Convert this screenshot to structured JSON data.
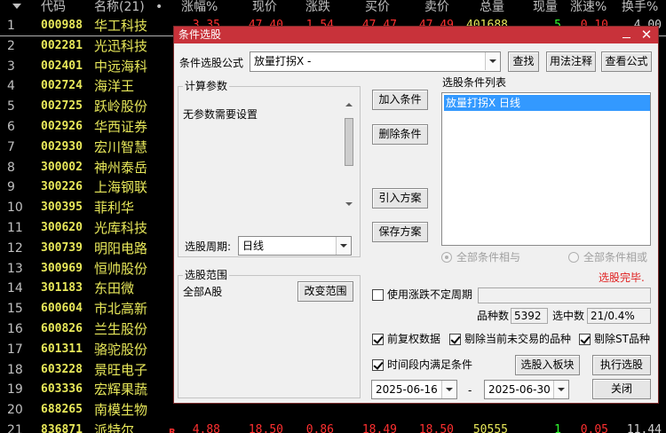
{
  "table": {
    "headers": [
      "代码",
      "名称(21)",
      "•",
      "涨幅%",
      "现价",
      "涨跌",
      "买价",
      "卖价",
      "总量",
      "现量",
      "涨速%",
      "换手%"
    ],
    "rows": [
      {
        "n": "1",
        "code": "000988",
        "name": "华工科技",
        "flag": "",
        "pct": "3.35",
        "price": "47.40",
        "chg": "1.54",
        "buy": "47.47",
        "sell": "47.49",
        "vol": "401688",
        "cur": "5",
        "spd": "0.10",
        "turn": "4.00",
        "sel": true
      },
      {
        "n": "2",
        "code": "002281",
        "name": "光迅科技",
        "flag": "",
        "pct": "",
        "price": "",
        "chg": "",
        "buy": "",
        "sell": "",
        "vol": "",
        "cur": "",
        "spd": "",
        "turn": ""
      },
      {
        "n": "3",
        "code": "002401",
        "name": "中远海科",
        "flag": "",
        "pct": "",
        "price": "",
        "chg": "",
        "buy": "",
        "sell": "",
        "vol": "",
        "cur": "",
        "spd": "",
        "turn": ""
      },
      {
        "n": "4",
        "code": "002724",
        "name": "海洋王",
        "flag": "",
        "pct": "",
        "price": "",
        "chg": "",
        "buy": "",
        "sell": "",
        "vol": "",
        "cur": "",
        "spd": "",
        "turn": ""
      },
      {
        "n": "5",
        "code": "002725",
        "name": "跃岭股份",
        "flag": "",
        "pct": "",
        "price": "",
        "chg": "",
        "buy": "",
        "sell": "",
        "vol": "",
        "cur": "",
        "spd": "",
        "turn": ""
      },
      {
        "n": "6",
        "code": "002926",
        "name": "华西证券",
        "flag": "",
        "pct": "",
        "price": "",
        "chg": "",
        "buy": "",
        "sell": "",
        "vol": "",
        "cur": "",
        "spd": "",
        "turn": ""
      },
      {
        "n": "7",
        "code": "002930",
        "name": "宏川智慧",
        "flag": "",
        "pct": "",
        "price": "",
        "chg": "",
        "buy": "",
        "sell": "",
        "vol": "",
        "cur": "",
        "spd": "",
        "turn": ""
      },
      {
        "n": "8",
        "code": "300002",
        "name": "神州泰岳",
        "flag": "",
        "pct": "",
        "price": "",
        "chg": "",
        "buy": "",
        "sell": "",
        "vol": "",
        "cur": "",
        "spd": "",
        "turn": ""
      },
      {
        "n": "9",
        "code": "300226",
        "name": "上海钢联",
        "flag": "",
        "pct": "",
        "price": "",
        "chg": "",
        "buy": "",
        "sell": "",
        "vol": "",
        "cur": "",
        "spd": "",
        "turn": ""
      },
      {
        "n": "10",
        "code": "300395",
        "name": "菲利华",
        "flag": "",
        "pct": "",
        "price": "",
        "chg": "",
        "buy": "",
        "sell": "",
        "vol": "",
        "cur": "",
        "spd": "",
        "turn": ""
      },
      {
        "n": "11",
        "code": "300620",
        "name": "光库科技",
        "flag": "",
        "pct": "",
        "price": "",
        "chg": "",
        "buy": "",
        "sell": "",
        "vol": "",
        "cur": "",
        "spd": "",
        "turn": ""
      },
      {
        "n": "12",
        "code": "300739",
        "name": "明阳电路",
        "flag": "",
        "pct": "",
        "price": "",
        "chg": "",
        "buy": "",
        "sell": "",
        "vol": "",
        "cur": "",
        "spd": "",
        "turn": ""
      },
      {
        "n": "13",
        "code": "300969",
        "name": "恒帅股份",
        "flag": "",
        "pct": "",
        "price": "",
        "chg": "",
        "buy": "",
        "sell": "",
        "vol": "",
        "cur": "",
        "spd": "",
        "turn": ""
      },
      {
        "n": "14",
        "code": "301183",
        "name": "东田微",
        "flag": "",
        "pct": "",
        "price": "",
        "chg": "",
        "buy": "",
        "sell": "",
        "vol": "",
        "cur": "",
        "spd": "",
        "turn": ""
      },
      {
        "n": "15",
        "code": "600604",
        "name": "市北高新",
        "flag": "",
        "pct": "",
        "price": "",
        "chg": "",
        "buy": "",
        "sell": "",
        "vol": "",
        "cur": "",
        "spd": "",
        "turn": ""
      },
      {
        "n": "16",
        "code": "600826",
        "name": "兰生股份",
        "flag": "",
        "pct": "",
        "price": "",
        "chg": "",
        "buy": "",
        "sell": "",
        "vol": "",
        "cur": "",
        "spd": "",
        "turn": ""
      },
      {
        "n": "17",
        "code": "601311",
        "name": "骆驼股份",
        "flag": "",
        "pct": "",
        "price": "",
        "chg": "",
        "buy": "",
        "sell": "",
        "vol": "",
        "cur": "",
        "spd": "",
        "turn": ""
      },
      {
        "n": "18",
        "code": "603228",
        "name": "景旺电子",
        "flag": "",
        "pct": "",
        "price": "",
        "chg": "",
        "buy": "",
        "sell": "",
        "vol": "",
        "cur": "",
        "spd": "",
        "turn": ""
      },
      {
        "n": "19",
        "code": "603336",
        "name": "宏辉果蔬",
        "flag": "",
        "pct": "",
        "price": "",
        "chg": "",
        "buy": "",
        "sell": "",
        "vol": "",
        "cur": "",
        "spd": "",
        "turn": ""
      },
      {
        "n": "20",
        "code": "688265",
        "name": "南模生物",
        "flag": "",
        "pct": "",
        "price": "",
        "chg": "",
        "buy": "",
        "sell": "",
        "vol": "",
        "cur": "",
        "spd": "",
        "turn": ""
      },
      {
        "n": "21",
        "code": "836871",
        "name": "派特尔",
        "flag": "R",
        "pct": "4.88",
        "price": "18.50",
        "chg": "0.86",
        "buy": "18.49",
        "sell": "18.50",
        "vol": "50555",
        "cur": "1",
        "spd": "0.05",
        "turn": "11.44"
      }
    ]
  },
  "dialog": {
    "title": "条件选股",
    "close_glyph": "✕",
    "formula_label": "条件选股公式",
    "formula_value": "放量打拐X   -",
    "find_button": "查找",
    "usage_button": "用法注释",
    "view_formula_button": "查看公式",
    "params_group": "计算参数",
    "params_text": "无参数需要设置",
    "add_condition": "加入条件",
    "delete_condition": "删除条件",
    "import_plan": "引入方案",
    "save_plan": "保存方案",
    "cond_list_label": "选股条件列表",
    "cond_list_items": [
      "放量打拐X  日线"
    ],
    "period_label": "选股周期:",
    "period_value": "日线",
    "radio_and": "全部条件相与",
    "radio_or": "全部条件相或",
    "status": "选股完毕.",
    "range_group": "选股范围",
    "range_value": "全部A股",
    "change_range": "改变范围",
    "use_period_label": "使用涨跌不定周期",
    "count_label": "品种数",
    "count_value": "5392",
    "selected_label": "选中数",
    "selected_value": "21/0.4%",
    "pre_rights": "前复权数据",
    "exclude_untraded": "剔除当前未交易的品种",
    "exclude_st": "剔除ST品种",
    "time_range": "时间段内满足条件",
    "to_block": "选股入板块",
    "execute": "执行选股",
    "date_from": "2025-06-16",
    "date_dash": "-",
    "date_to": "2025-06-30",
    "close_button": "关闭"
  }
}
